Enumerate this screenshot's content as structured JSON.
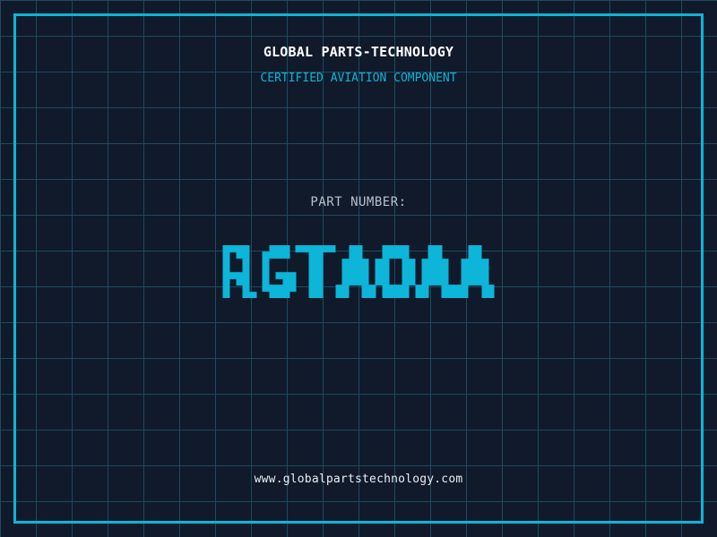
{
  "header": {
    "title": "GLOBAL PARTS-TECHNOLOGY",
    "subtitle": "CERTIFIED AVIATION COMPONENT"
  },
  "part": {
    "label": "PART NUMBER:",
    "number": "RGTAOAA"
  },
  "footer": {
    "url": "www.globalpartstechnology.com"
  },
  "colors": {
    "background": "#101a2b",
    "grid_line": "#1e4a5e",
    "frame_cyan": "#0db5d8",
    "accent_cyan": "#0db5d8",
    "title_white": "#ffffff",
    "label_gray": "#b8c1cb",
    "footer_light": "#e9eef3"
  }
}
